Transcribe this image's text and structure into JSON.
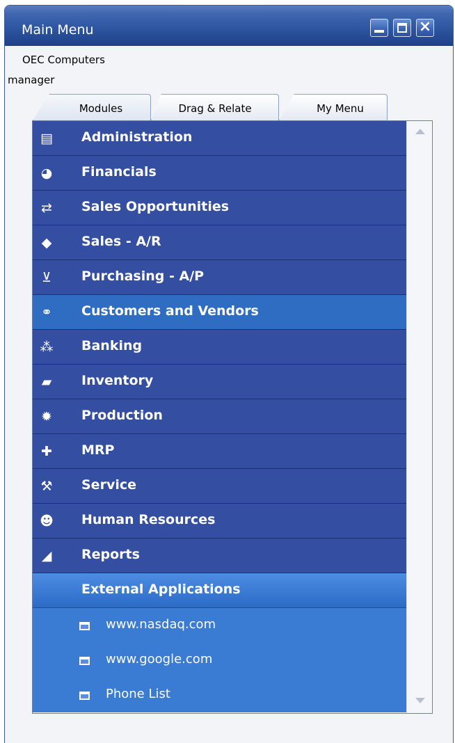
{
  "window": {
    "title": "Main Menu"
  },
  "company": "OEC Computers",
  "user": "manager",
  "tabs": [
    {
      "label": "Modules",
      "active": true
    },
    {
      "label": "Drag & Relate",
      "active": false
    },
    {
      "label": "My Menu",
      "active": false
    }
  ],
  "menu": {
    "items": [
      {
        "label": "Administration",
        "icon": "document-stack-icon"
      },
      {
        "label": "Financials",
        "icon": "financials-icon"
      },
      {
        "label": "Sales Opportunities",
        "icon": "opportunity-arrows-icon"
      },
      {
        "label": "Sales - A/R",
        "icon": "price-tag-icon"
      },
      {
        "label": "Purchasing - A/P",
        "icon": "shopping-cart-icon"
      },
      {
        "label": "Customers and Vendors",
        "icon": "handshake-icon",
        "highlighted": true
      },
      {
        "label": "Banking",
        "icon": "coins-icon"
      },
      {
        "label": "Inventory",
        "icon": "box-icon"
      },
      {
        "label": "Production",
        "icon": "gear-icon"
      },
      {
        "label": "MRP",
        "icon": "mrp-icon"
      },
      {
        "label": "Service",
        "icon": "wrench-icon"
      },
      {
        "label": "Human Resources",
        "icon": "people-icon"
      },
      {
        "label": "Reports",
        "icon": "chart-icon"
      }
    ],
    "folder": {
      "label": "External Applications"
    },
    "subitems": [
      {
        "label": "www.nasdaq.com"
      },
      {
        "label": "www.google.com"
      },
      {
        "label": "Phone List"
      }
    ]
  },
  "colors": {
    "menu_item": "#344ea2",
    "menu_item_highlight": "#2f6dc3",
    "submenu_bg": "#3a7bd3",
    "titlebar": "#2e56a1"
  }
}
